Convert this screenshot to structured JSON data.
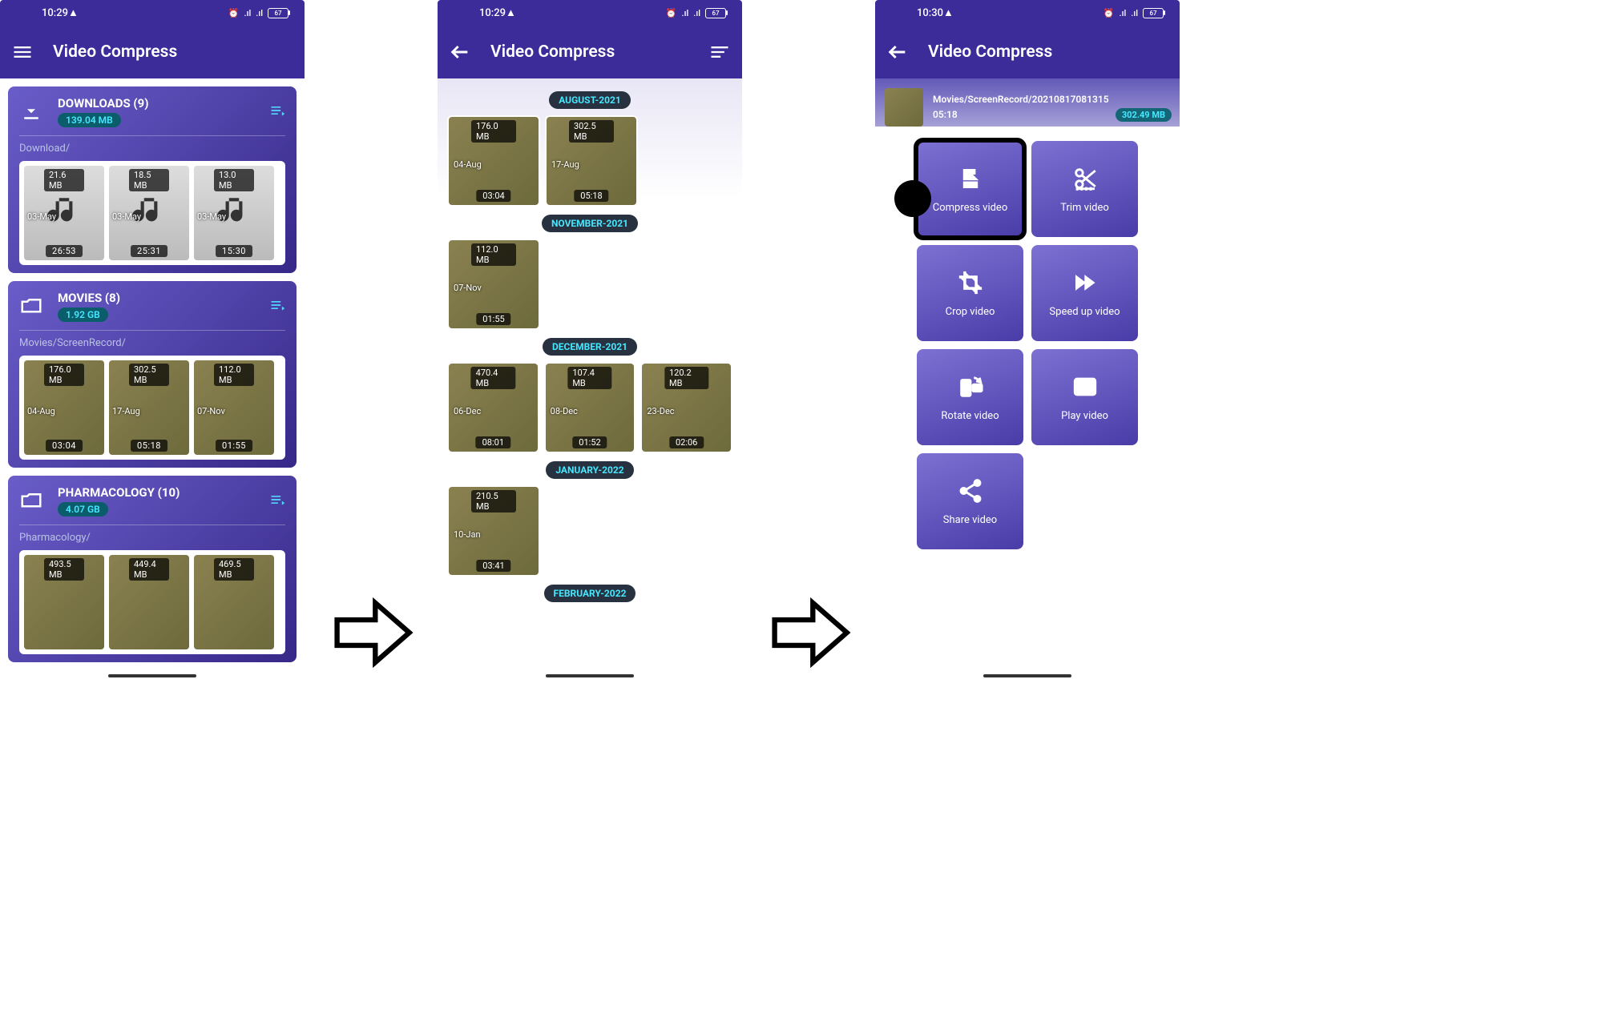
{
  "phone1": {
    "time": "10:29",
    "battery": "67",
    "title": "Video Compress",
    "folders": [
      {
        "name": "DOWNLOADS (9)",
        "size": "139.04 MB",
        "path": "Download/",
        "type": "audio",
        "items": [
          {
            "size": "21.6 MB",
            "date": "03-May",
            "dur": "26:53"
          },
          {
            "size": "18.5 MB",
            "date": "03-May",
            "dur": "25:31"
          },
          {
            "size": "13.0 MB",
            "date": "03-May",
            "dur": "15:30"
          }
        ]
      },
      {
        "name": "MOVIES (8)",
        "size": "1.92 GB",
        "path": "Movies/ScreenRecord/",
        "type": "video",
        "items": [
          {
            "size": "176.0 MB",
            "date": "04-Aug",
            "dur": "03:04"
          },
          {
            "size": "302.5 MB",
            "date": "17-Aug",
            "dur": "05:18"
          },
          {
            "size": "112.0 MB",
            "date": "07-Nov",
            "dur": "01:55"
          }
        ]
      },
      {
        "name": "PHARMACOLOGY (10)",
        "size": "4.07 GB",
        "path": "Pharmacology/",
        "type": "video",
        "items": [
          {
            "size": "493.5 MB",
            "date": "",
            "dur": ""
          },
          {
            "size": "449.4 MB",
            "date": "",
            "dur": ""
          },
          {
            "size": "469.5 MB",
            "date": "",
            "dur": ""
          }
        ]
      }
    ]
  },
  "phone2": {
    "time": "10:29",
    "battery": "67",
    "title": "Video Compress",
    "months": [
      {
        "label": "AUGUST-2021",
        "items": [
          {
            "size": "176.0 MB",
            "date": "04-Aug",
            "dur": "03:04"
          },
          {
            "size": "302.5 MB",
            "date": "17-Aug",
            "dur": "05:18"
          }
        ]
      },
      {
        "label": "NOVEMBER-2021",
        "items": [
          {
            "size": "112.0 MB",
            "date": "07-Nov",
            "dur": "01:55"
          }
        ]
      },
      {
        "label": "DECEMBER-2021",
        "items": [
          {
            "size": "470.4 MB",
            "date": "06-Dec",
            "dur": "08:01"
          },
          {
            "size": "107.4 MB",
            "date": "08-Dec",
            "dur": "01:52"
          },
          {
            "size": "120.2 MB",
            "date": "23-Dec",
            "dur": "02:06"
          }
        ]
      },
      {
        "label": "JANUARY-2022",
        "items": [
          {
            "size": "210.5 MB",
            "date": "10-Jan",
            "dur": "03:41"
          }
        ]
      },
      {
        "label": "FEBRUARY-2022",
        "items": []
      }
    ]
  },
  "phone3": {
    "time": "10:30",
    "battery": "67",
    "title": "Video Compress",
    "file": {
      "path": "Movies/ScreenRecord/20210817081315",
      "duration": "05:18",
      "size": "302.49 MB"
    },
    "actions": {
      "compress": "Compress video",
      "trim": "Trim video",
      "crop": "Crop video",
      "speed": "Speed up video",
      "rotate": "Rotate video",
      "play": "Play video",
      "share": "Share video"
    }
  }
}
